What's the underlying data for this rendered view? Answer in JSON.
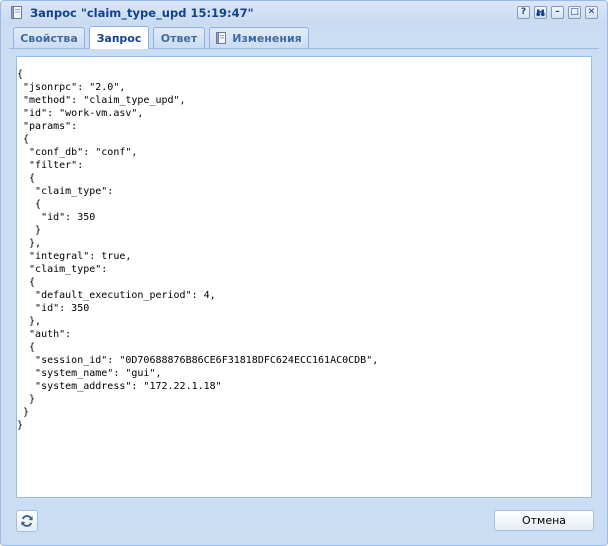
{
  "window": {
    "title": "Запрос \"claim_type_upd 15:19:47\"",
    "tools": {
      "help": "?",
      "minimize": "–",
      "maximize": "□",
      "close": "✕"
    }
  },
  "tabs": [
    {
      "label": "Свойства",
      "active": false
    },
    {
      "label": "Запрос",
      "active": true
    },
    {
      "label": "Ответ",
      "active": false
    },
    {
      "label": "Изменения",
      "active": false,
      "icon": "book-icon"
    }
  ],
  "request_body": "{\n \"jsonrpc\": \"2.0\",\n \"method\": \"claim_type_upd\",\n \"id\": \"work-vm.asv\",\n \"params\":\n {\n  \"conf_db\": \"conf\",\n  \"filter\":\n  {\n   \"claim_type\":\n   {\n    \"id\": 350\n   }\n  },\n  \"integral\": true,\n  \"claim_type\":\n  {\n   \"default_execution_period\": 4,\n   \"id\": 350\n  },\n  \"auth\":\n  {\n   \"session_id\": \"0D70688876B86CE6F31818DFC624ECC161AC0CDB\",\n   \"system_name\": \"gui\",\n   \"system_address\": \"172.22.1.18\"\n  }\n }\n}",
  "footer": {
    "refresh_icon": "refresh-icon",
    "cancel_label": "Отмена"
  },
  "colors": {
    "window_bg": "#cbddf3",
    "title_text": "#15428b",
    "border": "#99bbe8"
  }
}
